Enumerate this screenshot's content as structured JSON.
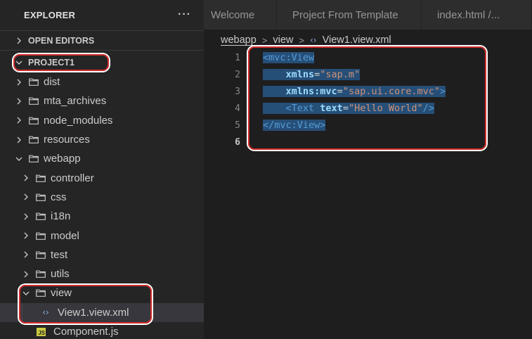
{
  "sidebar": {
    "title": "EXPLORER",
    "more_label": "···",
    "open_editors_label": "OPEN EDITORS",
    "project_label": "PROJECT1",
    "tree": [
      {
        "label": "dist"
      },
      {
        "label": "mta_archives"
      },
      {
        "label": "node_modules"
      },
      {
        "label": "resources"
      },
      {
        "label": "webapp"
      },
      {
        "label": "controller"
      },
      {
        "label": "css"
      },
      {
        "label": "i18n"
      },
      {
        "label": "model"
      },
      {
        "label": "test"
      },
      {
        "label": "utils"
      },
      {
        "label": "view"
      },
      {
        "label": "View1.view.xml"
      },
      {
        "label": "Component.js"
      }
    ]
  },
  "tabs": [
    {
      "label": "Welcome"
    },
    {
      "label": "Project From Template"
    },
    {
      "label": "index.html /..."
    }
  ],
  "breadcrumb": {
    "segments": [
      "webapp",
      "view",
      "View1.view.xml"
    ]
  },
  "editor": {
    "line_numbers": [
      "1",
      "2",
      "3",
      "4",
      "5",
      "6"
    ],
    "tokens": {
      "l1_tag": "<mvc:View",
      "l2_attr": "xmlns",
      "l2_eq": "=",
      "l2_str": "\"sap.m\"",
      "l3_attr": "xmlns:mvc",
      "l3_eq": "=",
      "l3_str": "\"sap.ui.core.mvc\"",
      "l3_close": ">",
      "l4_tag": "<Text",
      "l4_attr": "text",
      "l4_eq": "=",
      "l4_str": "\"Hello World\"",
      "l4_close": "/>",
      "l5_tag": "</mvc:View>"
    }
  },
  "colors": {
    "annotation": "#d22b2b",
    "selection": "#264f78",
    "tag": "#569cd6",
    "attribute": "#9cdcfe",
    "string": "#ce9178"
  }
}
